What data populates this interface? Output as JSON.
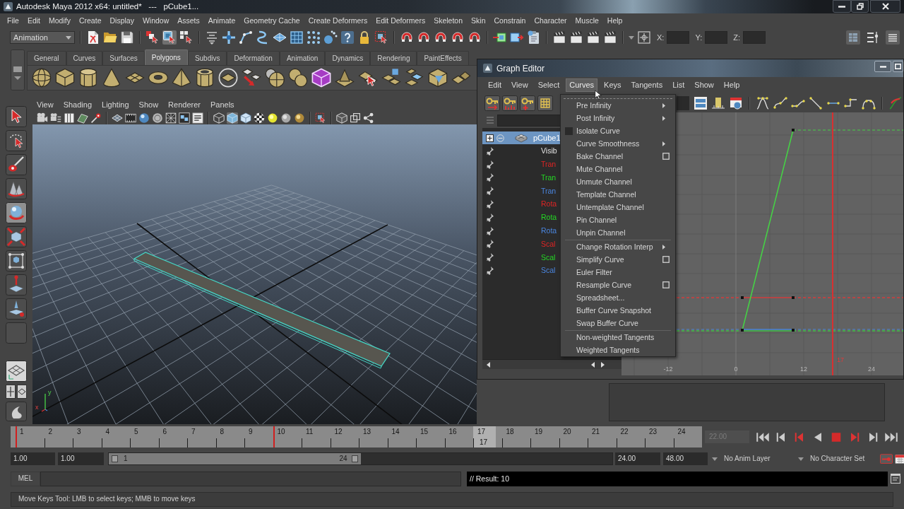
{
  "title_bar": {
    "title": "Autodesk Maya 2012 x64: untitled*   ---   pCube1..."
  },
  "menu_bar": [
    "File",
    "Edit",
    "Modify",
    "Create",
    "Display",
    "Window",
    "Assets",
    "Animate",
    "Geometry Cache",
    "Create Deformers",
    "Edit Deformers",
    "Skeleton",
    "Skin",
    "Constrain",
    "Character",
    "Muscle",
    "Help"
  ],
  "status_line": {
    "menu_set": "Animation",
    "selection_modes": [
      {
        "selected": false
      },
      {
        "selected": true
      },
      {
        "selected": false
      }
    ],
    "coordinate_fields": [
      {
        "label": "X:"
      },
      {
        "label": "Y:"
      },
      {
        "label": "Z:"
      }
    ]
  },
  "shelf": {
    "tabs": [
      {
        "label": "General",
        "selected": false
      },
      {
        "label": "Curves",
        "selected": false
      },
      {
        "label": "Surfaces",
        "selected": false
      },
      {
        "label": "Polygons",
        "selected": true
      },
      {
        "label": "Subdivs",
        "selected": false
      },
      {
        "label": "Deformation",
        "selected": false
      },
      {
        "label": "Animation",
        "selected": false
      },
      {
        "label": "Dynamics",
        "selected": false
      },
      {
        "label": "Rendering",
        "selected": false
      },
      {
        "label": "PaintEffects",
        "selected": false
      }
    ]
  },
  "toolbox": {
    "tools": [
      {
        "selected": false
      },
      {
        "selected": false
      },
      {
        "selected": false
      },
      {
        "selected": false
      },
      {
        "selected": true
      },
      {
        "selected": false
      },
      {
        "selected": false
      },
      {
        "selected": false
      },
      {
        "selected": false
      },
      {
        "selected": false
      }
    ]
  },
  "viewport_panel": {
    "menu": [
      "View",
      "Shading",
      "Lighting",
      "Show",
      "Renderer",
      "Panels"
    ],
    "axis_labels": [
      "y",
      "x"
    ]
  },
  "graph_editor": {
    "title": "Graph Editor",
    "menu": [
      {
        "label": "Edit",
        "selected": false
      },
      {
        "label": "View",
        "selected": false
      },
      {
        "label": "Select",
        "selected": false
      },
      {
        "label": "Curves",
        "selected": true
      },
      {
        "label": "Keys",
        "selected": false
      },
      {
        "label": "Tangents",
        "selected": false
      },
      {
        "label": "List",
        "selected": false
      },
      {
        "label": "Show",
        "selected": false
      },
      {
        "label": "Help",
        "selected": false
      }
    ],
    "outliner": {
      "object": {
        "label": "pCube1",
        "selected": true
      },
      "channels": [
        {
          "label": "Visib"
        },
        {
          "label": "Tran",
          "color": "#e02424"
        },
        {
          "label": "Tran",
          "color": "#24d824"
        },
        {
          "label": "Tran",
          "color": "#4a86e0"
        },
        {
          "label": "Rota",
          "color": "#e02424"
        },
        {
          "label": "Rota",
          "color": "#24d824"
        },
        {
          "label": "Rota",
          "color": "#4a86e0"
        },
        {
          "label": "Scal",
          "color": "#e02424"
        },
        {
          "label": "Scal",
          "color": "#24d824"
        },
        {
          "label": "Scal",
          "color": "#4a86e0"
        }
      ]
    },
    "curves_menu": {
      "sections": [
        {
          "items": [
            {
              "label": "Pre Infinity",
              "kind": "submenu"
            },
            {
              "label": "Post Infinity",
              "kind": "submenu"
            },
            {
              "label": "Isolate Curve",
              "kind": "checkbox",
              "checked": false
            },
            {
              "label": "Curve Smoothness",
              "kind": "submenu"
            },
            {
              "label": "Bake Channel",
              "kind": "option"
            },
            {
              "label": "Mute Channel",
              "kind": "command"
            },
            {
              "label": "Unmute Channel",
              "kind": "command"
            },
            {
              "label": "Template Channel",
              "kind": "command"
            },
            {
              "label": "Untemplate Channel",
              "kind": "command"
            },
            {
              "label": "Pin Channel",
              "kind": "command"
            },
            {
              "label": "Unpin Channel",
              "kind": "command"
            }
          ]
        },
        {
          "items": [
            {
              "label": "Change Rotation Interp",
              "kind": "submenu"
            },
            {
              "label": "Simplify Curve",
              "kind": "option"
            },
            {
              "label": "Euler Filter",
              "kind": "command"
            },
            {
              "label": "Resample Curve",
              "kind": "option"
            },
            {
              "label": "Spreadsheet...",
              "kind": "command"
            },
            {
              "label": "Buffer Curve Snapshot",
              "kind": "command"
            },
            {
              "label": "Swap Buffer Curve",
              "kind": "command"
            }
          ]
        },
        {
          "items": [
            {
              "label": "Non-weighted Tangents",
              "kind": "command"
            },
            {
              "label": "Weighted Tangents",
              "kind": "command"
            }
          ]
        }
      ]
    },
    "graph": {
      "x_ticks": [
        "-12",
        "0",
        "12",
        "24"
      ],
      "current_time": "17"
    }
  },
  "time_slider": {
    "frames": [
      {
        "label": "1",
        "key": true,
        "selected": false
      },
      {
        "label": "2",
        "key": false,
        "selected": false
      },
      {
        "label": "3",
        "key": false,
        "selected": false
      },
      {
        "label": "4",
        "key": false,
        "selected": false
      },
      {
        "label": "5",
        "key": false,
        "selected": false
      },
      {
        "label": "6",
        "key": false,
        "selected": false
      },
      {
        "label": "7",
        "key": false,
        "selected": false
      },
      {
        "label": "8",
        "key": false,
        "selected": false
      },
      {
        "label": "9",
        "key": false,
        "selected": false
      },
      {
        "label": "10",
        "key": true,
        "selected": false
      },
      {
        "label": "11",
        "key": false,
        "selected": false
      },
      {
        "label": "12",
        "key": false,
        "selected": false
      },
      {
        "label": "13",
        "key": false,
        "selected": false
      },
      {
        "label": "14",
        "key": false,
        "selected": false
      },
      {
        "label": "15",
        "key": false,
        "selected": false
      },
      {
        "label": "16",
        "key": false,
        "selected": false
      },
      {
        "label": "17",
        "key": false,
        "selected": true
      },
      {
        "label": "18",
        "key": false,
        "selected": false
      },
      {
        "label": "19",
        "key": false,
        "selected": false
      },
      {
        "label": "20",
        "key": false,
        "selected": false
      },
      {
        "label": "21",
        "key": false,
        "selected": false
      },
      {
        "label": "22",
        "key": false,
        "selected": false
      },
      {
        "label": "23",
        "key": false,
        "selected": false
      },
      {
        "label": "24",
        "key": false,
        "selected": false
      }
    ],
    "current_frame": "17",
    "end_field": {
      "value": "22.00",
      "disabled": true
    }
  },
  "range_slider": {
    "start_time": "1.00",
    "playback_start": "1.00",
    "range_start": "1",
    "range_end": "24",
    "level": 0.5,
    "playback_end": "24.00",
    "end_time": "48.00",
    "anim_layer": "No Anim Layer",
    "character_set": "No Character Set"
  },
  "command_line": {
    "language": "MEL",
    "result": "// Result: 10"
  },
  "help_line": {
    "text": "Move Keys Tool: LMB to select keys; MMB to move keys"
  }
}
